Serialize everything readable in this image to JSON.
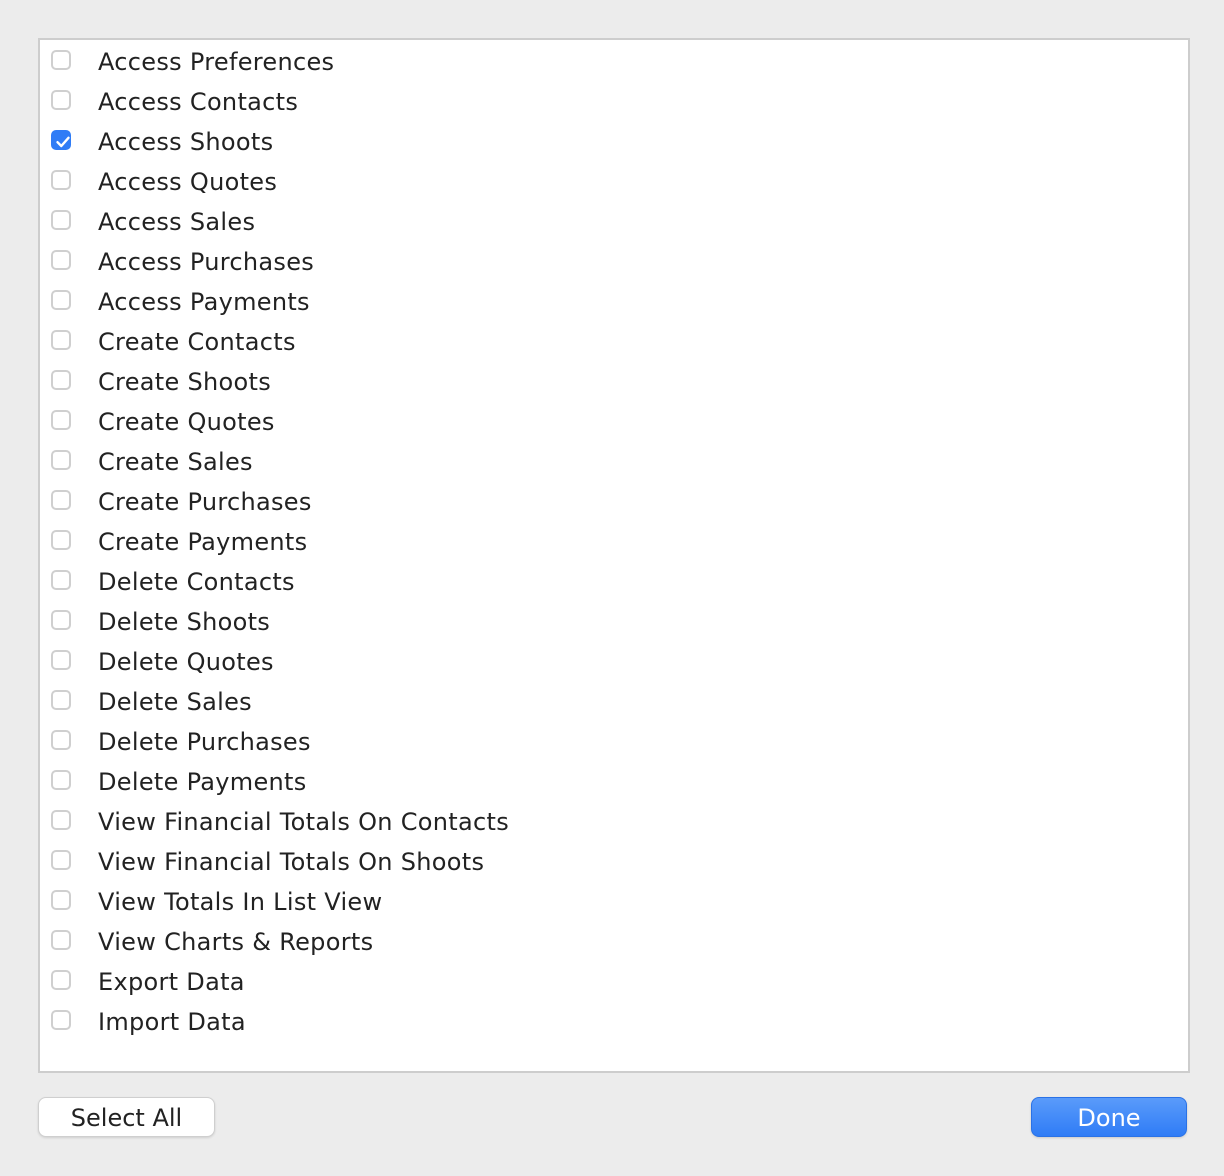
{
  "permissions": [
    {
      "label": "Access Preferences",
      "checked": false
    },
    {
      "label": "Access Contacts",
      "checked": false
    },
    {
      "label": "Access Shoots",
      "checked": true
    },
    {
      "label": "Access Quotes",
      "checked": false
    },
    {
      "label": "Access Sales",
      "checked": false
    },
    {
      "label": "Access Purchases",
      "checked": false
    },
    {
      "label": "Access Payments",
      "checked": false
    },
    {
      "label": "Create Contacts",
      "checked": false
    },
    {
      "label": "Create Shoots",
      "checked": false
    },
    {
      "label": "Create Quotes",
      "checked": false
    },
    {
      "label": "Create Sales",
      "checked": false
    },
    {
      "label": "Create Purchases",
      "checked": false
    },
    {
      "label": "Create Payments",
      "checked": false
    },
    {
      "label": "Delete Contacts",
      "checked": false
    },
    {
      "label": "Delete Shoots",
      "checked": false
    },
    {
      "label": "Delete Quotes",
      "checked": false
    },
    {
      "label": "Delete Sales",
      "checked": false
    },
    {
      "label": "Delete Purchases",
      "checked": false
    },
    {
      "label": "Delete Payments",
      "checked": false
    },
    {
      "label": "View Financial Totals On Contacts",
      "checked": false
    },
    {
      "label": "View Financial Totals On Shoots",
      "checked": false
    },
    {
      "label": "View Totals In List View",
      "checked": false
    },
    {
      "label": "View Charts & Reports",
      "checked": false
    },
    {
      "label": "Export Data",
      "checked": false
    },
    {
      "label": "Import Data",
      "checked": false
    }
  ],
  "buttons": {
    "select_all_label": "Select All",
    "done_label": "Done"
  },
  "colors": {
    "accent": "#2f7cf6",
    "background": "#ececec",
    "list_background": "#ffffff"
  }
}
